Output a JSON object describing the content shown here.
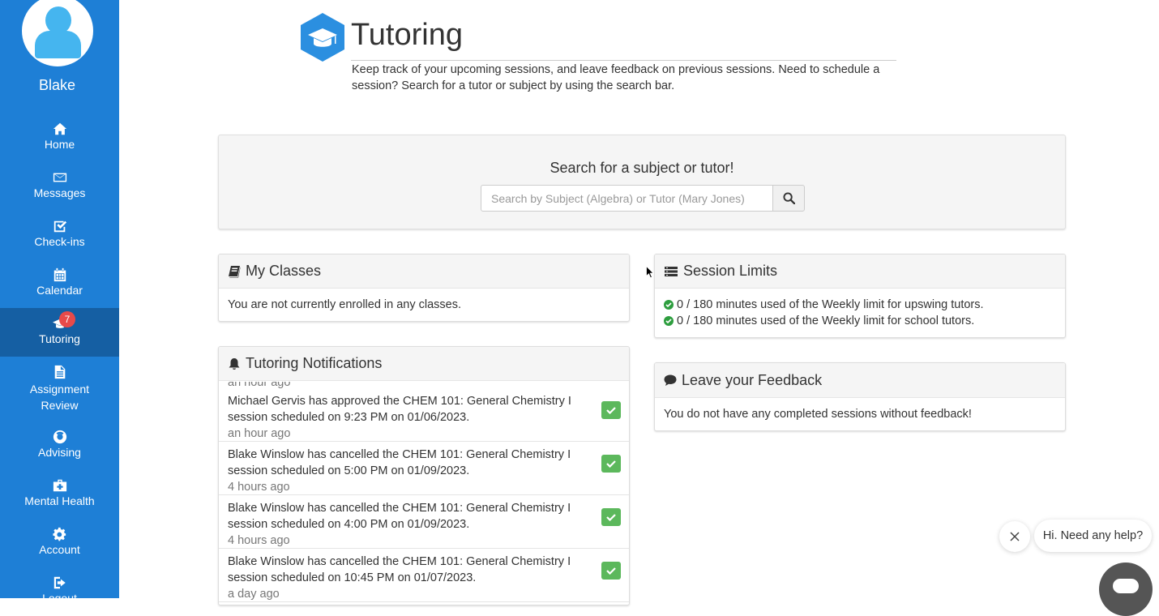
{
  "sidebar": {
    "user_name": "Blake",
    "items": [
      {
        "label": "Home",
        "icon": "home-icon"
      },
      {
        "label": "Messages",
        "icon": "envelope-icon"
      },
      {
        "label": "Check-ins",
        "icon": "checkbox-icon"
      },
      {
        "label": "Calendar",
        "icon": "calendar-icon"
      },
      {
        "label": "Tutoring",
        "icon": "graduation-cap-icon",
        "badge": "7",
        "active": true
      },
      {
        "label": "Assignment Review",
        "icon": "document-icon"
      },
      {
        "label": "Advising",
        "icon": "lifebuoy-icon"
      },
      {
        "label": "Mental Health",
        "icon": "medkit-icon"
      },
      {
        "label": "Account",
        "icon": "gear-icon"
      },
      {
        "label": "Logout",
        "icon": "logout-icon"
      }
    ]
  },
  "header": {
    "title": "Tutoring",
    "subtitle": "Keep track of your upcoming sessions, and leave feedback on previous sessions. Need to schedule a session? Search for a tutor or subject by using the search bar.",
    "icon_color": "#2b8fe0"
  },
  "search": {
    "heading": "Search for a subject or tutor!",
    "placeholder": "Search by Subject (Algebra) or Tutor (Mary Jones)",
    "value": ""
  },
  "my_classes": {
    "title": "My Classes",
    "message": "You are not currently enrolled in any classes."
  },
  "session_limits": {
    "title": "Session Limits",
    "rows": [
      "0 / 180 minutes used of the Weekly limit for upswing tutors.",
      "0 / 180 minutes used of the Weekly limit for school tutors."
    ]
  },
  "notifications": {
    "title": "Tutoring Notifications",
    "top_ago": "an hour ago",
    "items": [
      {
        "message": "Michael Gervis has approved the CHEM 101: General Chemistry I session scheduled on 9:23 PM on 01/06/2023.",
        "ago": "an hour ago"
      },
      {
        "message": "Blake Winslow has cancelled the CHEM 101: General Chemistry I session scheduled on 5:00 PM on 01/09/2023.",
        "ago": "4 hours ago"
      },
      {
        "message": "Blake Winslow has cancelled the CHEM 101: General Chemistry I session scheduled on 4:00 PM on 01/09/2023.",
        "ago": "4 hours ago"
      },
      {
        "message": "Blake Winslow has cancelled the CHEM 101: General Chemistry I session scheduled on 10:45 PM on 01/07/2023.",
        "ago": "a day ago"
      }
    ]
  },
  "feedback": {
    "title": "Leave your Feedback",
    "message": "You do not have any completed sessions without feedback!"
  },
  "chat": {
    "prompt": "Hi. Need any help?"
  }
}
